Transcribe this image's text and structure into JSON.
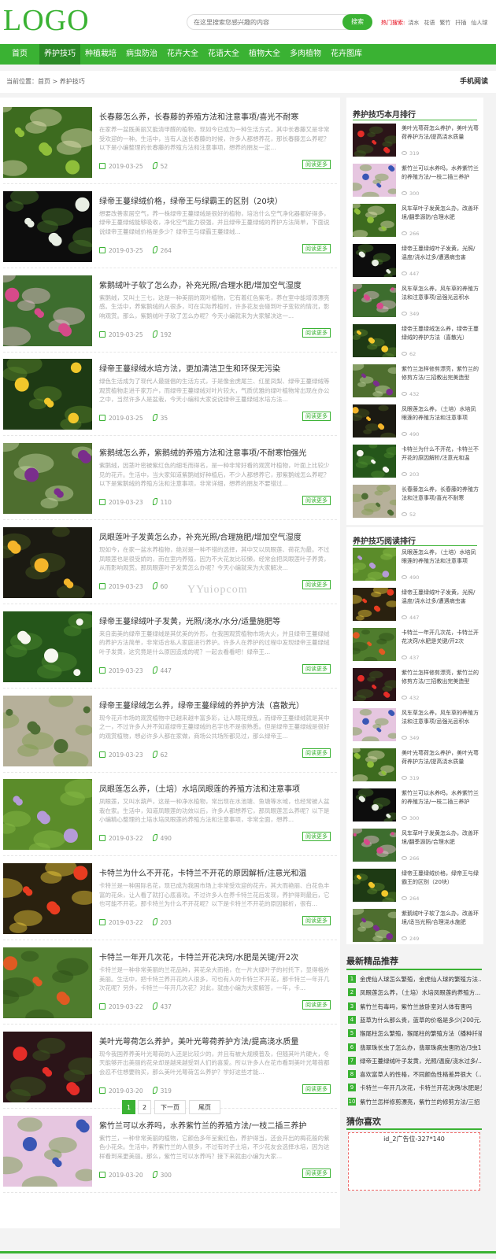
{
  "header": {
    "logo": "LOGO",
    "search_placeholder": "在这里搜索您感兴趣的内容",
    "search_button": "搜索",
    "hot_label": "热门搜索:",
    "hot_terms": [
      "浇水",
      "花语",
      "繁竹",
      "扦插",
      "仙人球"
    ]
  },
  "nav": {
    "items": [
      "首页",
      "养护技巧",
      "种植栽培",
      "病虫防治",
      "花卉大全",
      "花语大全",
      "植物大全",
      "多肉植物",
      "花卉图库"
    ],
    "active": 1
  },
  "breadcrumb": {
    "text": "当前位置：首页 > 养护技巧",
    "mobile": "手机阅读"
  },
  "articles": [
    {
      "title": "长春藤怎么养，长春藤的养殖方法和注意事项/喜光不耐寒",
      "desc": "在家养一盆既美丽又能清甲醛的植物，现如今已成为一种生活方式，其中长春藤又是非常受欢迎的一种。生活中，当有人送长春藤的时候，许多人都想养花，那长春藤怎么养呢？以下是小编整理的长春藤的养殖方法和注意事项，想养的朋友一定...",
      "date": "2019-03-25",
      "views": "52",
      "more": "阅读更多"
    },
    {
      "title": "绿帝王蔓绿绒价格，绿帝王与绿霸王的区别（20块）",
      "desc": "想要改善家居空气，养一株绿帝王蔓绿绒是很好的植物，培治什么空气净化器都好得多，绿帝王蔓绿绒能够吸收，净化空气能力很强，并且绿帝王蔓绿绒的养护方法简单，下面说说绿帝王蔓绿绒价格是多少？绿帝王与绿霸王蔓绿绒...",
      "date": "2019-03-25",
      "views": "264",
      "more": "阅读更多"
    },
    {
      "title": "紫鹅绒叶子软了怎么办，补充光照/合理水肥/增加空气湿度",
      "desc": "紫鹅绒，又叫土三七，这是一种美丽的观叶植物，它有着红色紫毛，养在室中能增添漂亮感。生活中，养紫鹅绒的人很多，可在实际养植时，许多花友会碰到叶子变软的情况，影响观赏。那么，紫鹅绒叶子软了怎么办呢？今天小编就来为大家解决这一...",
      "date": "2019-03-25",
      "views": "192",
      "more": "阅读更多"
    },
    {
      "title": "绿帝王蔓绿绒水培方法，更加清洁卫生和环保无污染",
      "desc": "绿色生活成为了现代人最提倡的生活方式，于是像金虎尾兰、红星凤梨、绿帝王蔓绿绒等观赏植物走进千家万户，而绿帝王蔓绿绒对叶片较大，气质优雅的绿叶植物常出现在办公之中，当然许多人是盆栽，今天小编和大家说说绿帝王蔓绿绒水培方法...",
      "date": "2019-03-25",
      "views": "35",
      "more": "阅读更多"
    },
    {
      "title": "紫鹅绒怎么养，紫鹅绒的养殖方法和注意事项/不耐寒怕强光",
      "desc": "紫鹅绒，因茎叶密被紫红色的细毛而得名，是一种非常好看的观赏叶植物，叶面上比较少见的花卉。生活中，当大家知道紫鹅绒好种植后，不少人都想养它，那紫鹅绒怎么养呢？以下是紫鹅绒的养殖方法和注意事项，非常详细，想养的朋友不要错过...",
      "date": "2019-03-23",
      "views": "110",
      "more": "阅读更多"
    },
    {
      "title": "凤眼莲叶子发黄怎么办，补充光照/合理施肥/增加空气湿度",
      "desc": "现如今，在家一盆水养植物，绝对是一种不错的选择，其中又以凤眼莲、荷花为最。不过凤眼莲也是很受娇的，而在室内养殖，因为不大花友比较懒，经常会把凤眼莲叶子养黄，从而影响观赏。那凤眼莲叶子发黄怎么办呢？今天小编就来为大家解决...",
      "date": "2019-03-23",
      "views": "60",
      "more": "阅读更多"
    },
    {
      "title": "绿帝王蔓绿绒叶子发黄，光照/浇水/水分/适量施肥等",
      "desc": "来自南美的绿帝王蔓绿绒是其优美的外形，在我国观赏植物市场大火，并且绿帝王蔓绿绒的养护方法简单，非常适合私人家庭进行养护。许多人在养护的过程中发现绿帝王蔓绿绒叶子发黄，这究竟是什么原因造成的呢？一起去看看吧！绿帝王...",
      "date": "2019-03-23",
      "views": "447",
      "more": "阅读更多"
    },
    {
      "title": "绿帝王蔓绿绒怎么养，绿帝王蔓绿绒的养护方法（喜散光）",
      "desc": "现今花卉市场的观赏植物中已越来越丰富多彩，让人眼花缭乱，而绿帝王蔓绿绒就是其中之一，不过许多人并不知道绿帝王蔓绿绒的名字也不是很熟悉。但是绿帝王蔓绿绒是很好的观赏植物，想必许多人都在家做，商场公共场所都见过，那么绿帝王...",
      "date": "2019-03-23",
      "views": "62",
      "more": "阅读更多"
    },
    {
      "title": "凤眼莲怎么养，（土培）水培凤眼莲的养殖方法和注意事项",
      "desc": "凤眼莲，又叫水葫芦，这是一种净水植物，常出现在水池塘、鱼塘等水域，也经常被人盆栽在家。生活中，知道凤眼莲的功效以后，许多人都想养它，那凤眼莲怎么养呢？以下是小编精心整理的土培水培凤眼莲的养殖方法和注意事项，非常全面，想养...",
      "date": "2019-03-22",
      "views": "490",
      "more": "阅读更多"
    },
    {
      "title": "卡特兰为什么不开花，卡特兰不开花的原因解析/注意光和温",
      "desc": "卡特兰是一种国际名花，现已成为我国市场上非常受欢迎的花卉，其大而艳丽、白花色丰富的花朵，让人看了就打心底喜欢。不过许多人在养卡特兰花后发现，养护得到最后，它也可能不开花，那卡特兰为什么不开花呢？以下是卡特兰不开花的原因解析，很有...",
      "date": "2019-03-22",
      "views": "203",
      "more": "阅读更多"
    },
    {
      "title": "卡特兰一年开几次花，卡特兰开花决窍/水肥是关键/开2次",
      "desc": "卡特兰是一种非常美丽的兰花品种，其花朵大而艳，在一片大绿叶子的衬托下，显得格外美丽。生活中，把卡特兰养开花的人很多，可也有人的卡特兰不开花，那卡特兰一年开几次花呢？另外，卡特兰一年开几次花？对此，就由小编为大家解答，一年，卡...",
      "date": "2019-03-22",
      "views": "437",
      "more": "阅读更多"
    },
    {
      "title": "美叶光萼荷怎么养护，美叶光萼荷养护方法/提高浇水质量",
      "desc": "现今我国养养美叶光萼荷的人还是比较少的，并且有被大规模普及，但随其叶片硬大，冬天能够开出美丽的花朵却是越来越受到人们的喜爱。所以许多人在花市看到美叶光萼荷都会忍不住想要购买，那么美叶光萼荷怎么养护？学好这些才能...",
      "date": "2019-03-20",
      "views": "319",
      "more": "阅读更多"
    },
    {
      "title": "紫竹兰可以水养吗，水养紫竹兰的养殖方法/一枝二插三养护",
      "desc": "紫竹兰，一种非常美丽的植物，它颜色多年呈紫红色，养护得当，还会开出的梅花般的紫色小花朵。生活中，养紫竹兰的人很多，不过有时子土培，不少花友会选择水培，因为这样看到来更美丽。那么，紫竹兰可以水养吗？接下来就由小编为大家...",
      "date": "2019-03-20",
      "views": "300",
      "more": "阅读更多"
    }
  ],
  "pager": {
    "pages": [
      "1",
      "2"
    ],
    "next": "下一页",
    "last": "尾页",
    "active": 0
  },
  "monthly": {
    "heading": "养护技巧本月排行",
    "items": [
      {
        "title": "美叶光萼荷怎么养护，美叶光萼荷养护方法/提高浇水质量",
        "views": "319"
      },
      {
        "title": "紫竹兰可以水养吗，水养紫竹兰的养殖方法/一枝二插三养护",
        "views": "300"
      },
      {
        "title": "风车草叶子发黄怎么办，改善环境/翻季源防/合理水肥",
        "views": "266"
      },
      {
        "title": "绿帝王蔓绿绒叶子发黄，光照/温度/浇水过多/遭遇病虫害",
        "views": "447"
      },
      {
        "title": "风车草怎么养，风车草的养殖方法和注意事项/忌强光忌积水",
        "views": "349"
      },
      {
        "title": "绿帝王蔓绿绒怎么养，绿帝王蔓绿绒的养护方法（喜散光）",
        "views": "62"
      },
      {
        "title": "紫竹兰怎样修剪漂亮，紫竹兰的修剪方法/三招教出完美造型",
        "views": "432"
      },
      {
        "title": "凤眼莲怎么养，（土培）水培凤眼莲的养殖方法和注意事项",
        "views": "490"
      },
      {
        "title": "卡特兰为什么不开花，卡特兰不开花的原因解析/注意光和温",
        "views": "203"
      },
      {
        "title": "长春藤怎么养，长春藤的养殖方法和注意事项/喜光不耐寒",
        "views": "52"
      }
    ]
  },
  "reading": {
    "heading": "养护技巧阅读排行",
    "items": [
      {
        "title": "凤眼莲怎么养，（土培）水培凤眼莲的养殖方法和注意事项",
        "views": "490"
      },
      {
        "title": "绿帝王蔓绿绒叶子发黄，光照/温度/浇水过多/遭遇病虫害",
        "views": "447"
      },
      {
        "title": "卡特兰一年开几次花，卡特兰开花决窍/水肥是关键/开2次",
        "views": "437"
      },
      {
        "title": "紫竹兰怎样修剪漂亮，紫竹兰的修剪方法/三招教出完美造型",
        "views": "432"
      },
      {
        "title": "风车草怎么养，风车草的养殖方法和注意事项/忌强光忌积水",
        "views": "349"
      },
      {
        "title": "美叶光萼荷怎么养护，美叶光萼荷养护方法/提高浇水质量",
        "views": "319"
      },
      {
        "title": "紫竹兰可以水养吗，水养紫竹兰的养殖方法/一枝二插三养护",
        "views": "300"
      },
      {
        "title": "风车草叶子发黄怎么办，改善环境/翻季源防/合理水肥",
        "views": "266"
      },
      {
        "title": "绿帝王蔓绿绒价格，绿帝王与绿霸王的区别（20块）",
        "views": "264"
      },
      {
        "title": "紫鹅绒叶子软了怎么办，改善环境/适当光照/合理浇水施肥",
        "views": "249"
      }
    ]
  },
  "recommend": {
    "heading": "最新精品推荐",
    "items": [
      "金虎仙人球怎么繁殖，金虎仙人球的繁殖方法...",
      "凤眼莲怎么养，（土培）水培凤眼莲的养殖方...",
      "紫竹兰有毒吗，紫竹兰放卧室对人体有害吗",
      "蓝草为什么那么贵，蓝草的价格是多少(200元...",
      "猴尾柱怎么繁殖，猴尾柱的繁殖方法（播种扦插）",
      "翡翠珠长虫了怎么办，翡翠珠病虫害防治/3虫1",
      "绿帝王蔓绿绒叶子发黄，光照/温度/浇水过多/...",
      "喜欢富草人的性格，不同颜色性格差异很大（...",
      "卡特兰一年开几次花，卡特兰开花决窍/水肥是关",
      "紫竹兰怎样修剪漂亮，紫竹兰的修剪方法/三招"
    ]
  },
  "guess": {
    "heading": "猜你喜欢",
    "ad_text": "id_2广告位-327*140"
  },
  "watermark": "YYuiopcom",
  "colors": {
    "accent": "#3ab233",
    "accent_dark": "#2c8a27",
    "hot": "#e60012"
  }
}
